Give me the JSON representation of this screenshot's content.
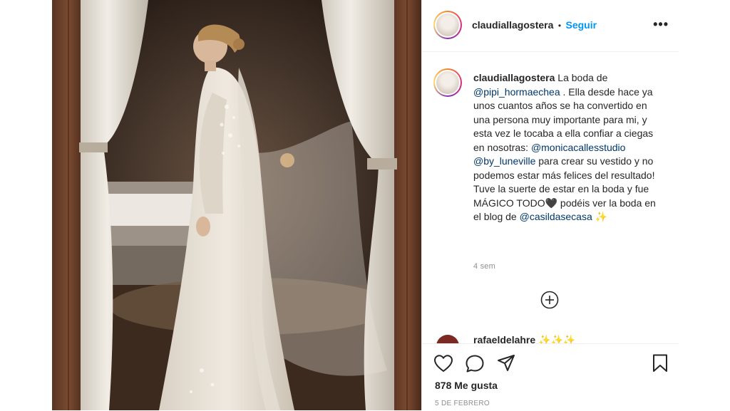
{
  "post": {
    "author": "claudiallagostera",
    "follow_separator": "•",
    "follow_label": "Seguir",
    "more_icon": "more-options-icon",
    "caption": {
      "username": "claudiallagostera",
      "parts": [
        {
          "text": " La boda de ",
          "mention": false
        },
        {
          "text": "@pipi_hormaechea",
          "mention": true
        },
        {
          "text": " . Ella desde hace ya unos cuantos años se ha convertido en una persona muy importante para mi, y esta vez le tocaba a ella confiar a ciegas en nosotras: ",
          "mention": false
        },
        {
          "text": "@monicacallesstudio",
          "mention": true
        },
        {
          "text": " ",
          "mention": false
        },
        {
          "text": "@by_luneville",
          "mention": true
        },
        {
          "text": " para crear su vestido y no podemos estar más felices del resultado! Tuve la suerte de estar en la boda y fue MÁGICO TODO",
          "mention": false
        },
        {
          "text": "🖤",
          "mention": false
        },
        {
          "text": " podéis ver la boda en el blog de ",
          "mention": false
        },
        {
          "text": "@casildasecasa",
          "mention": true
        },
        {
          "text": " ✨",
          "mention": false
        }
      ]
    },
    "time_ago": "4 sem",
    "load_more_icon": "plus-circle-icon",
    "next_comment_user": "rafaeldelahre",
    "next_comment_emoji": "✨✨✨",
    "likes": "878 Me gusta",
    "date": "5 DE FEBRERO"
  },
  "icons": {
    "like": "heart-icon",
    "comment": "comment-icon",
    "share": "paper-plane-icon",
    "save": "bookmark-icon"
  }
}
